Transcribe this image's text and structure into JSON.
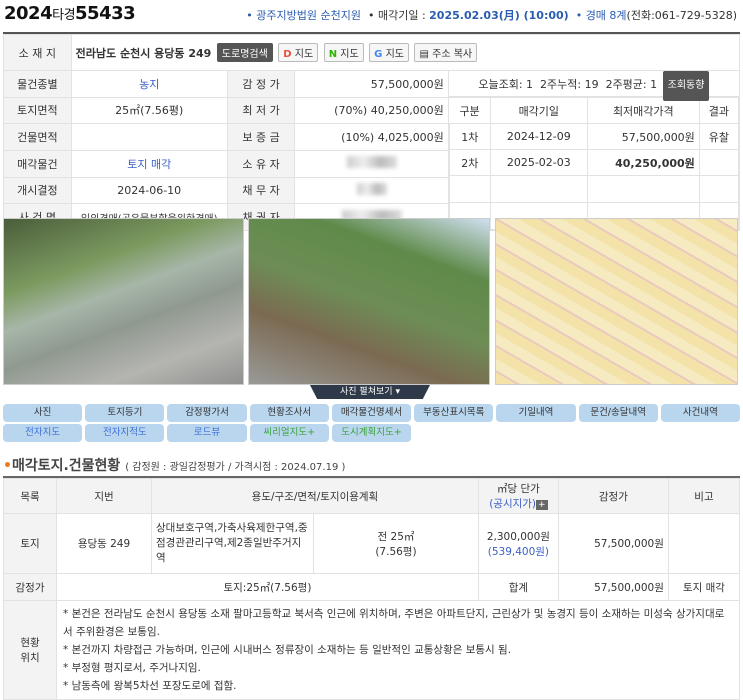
{
  "header": {
    "case_year": "2024",
    "case_type": "타경",
    "case_no": "55433",
    "court": "• 광주지방법원 순천지원",
    "sale_date_label": "• 매각기일 : ",
    "sale_date": "2025.02.03(月) (10:00)",
    "dept": "• 경매 8계",
    "phone": "(전화:061-729-5328)"
  },
  "info": {
    "address_label": "소 재 지",
    "address": "전라남도 순천시 용당동 249",
    "address_buttons": [
      "도로명검색",
      "지도",
      "지도",
      "지도",
      "주소 복사"
    ],
    "rows": [
      {
        "l1": "물건종별",
        "v1": "농지",
        "l2": "감 정 가",
        "v2": "57,500,000원"
      },
      {
        "l1": "토지면적",
        "v1": "25㎡(7.56평)",
        "l2": "최 저 가",
        "v2": "(70%) 40,250,000원"
      },
      {
        "l1": "건물면적",
        "v1": "",
        "l2": "보 증 금",
        "v2": "(10%) 4,025,000원"
      },
      {
        "l1": "매각물건",
        "v1": "토지 매각",
        "l2": "소 유 자",
        "v2": ""
      },
      {
        "l1": "개시결정",
        "v1": "2024-06-10",
        "l2": "채 무 자",
        "v2": ""
      },
      {
        "l1": "사 건 명",
        "v1": "임의경매(공유물분할을위한경매)",
        "l2": "채 권 자",
        "v2": ""
      }
    ],
    "views": "오늘조회: 1  2주누적: 19  2주평균: 1",
    "views_button": "조회동향",
    "history_headers": [
      "구분",
      "매각기일",
      "최저매각가격",
      "결과"
    ],
    "history": [
      {
        "round": "1차",
        "date": "2024-12-09",
        "price": "57,500,000원",
        "result": "유찰"
      },
      {
        "round": "2차",
        "date": "2025-02-03",
        "price": "40,250,000원",
        "result": ""
      }
    ]
  },
  "photos": {
    "spread_label": "사진 펼쳐보기"
  },
  "tabs_row1": [
    "사진",
    "토지등기",
    "감정평가서",
    "현황조사서",
    "매각물건명세서",
    "부동산표시목록",
    "기일내역",
    "문건/송달내역",
    "사건내역"
  ],
  "tabs_row2": [
    "전자지도",
    "전자지적도",
    "로드뷰",
    "씨리얼지도+",
    "도시계획지도+"
  ],
  "section": {
    "title": "매각토지.건물현황",
    "sub": "( 감정원 : 광일감정평가 / 가격시점 : 2024.07.19 )"
  },
  "land": {
    "headers": [
      "목록",
      "지번",
      "용도/구조/면적/토지이용계획",
      "㎡당 단가",
      "(공시지가)",
      "감정가",
      "비고"
    ],
    "row": {
      "type": "토지",
      "lot": "용당동 249",
      "use": "상대보호구역,가축사육제한구역,중점경관관리구역,제2종일반주거지역",
      "area1": "전 25㎡",
      "area2": "(7.56평)",
      "unit": "2,300,000원",
      "official": "(539,400원)",
      "appraisal": "57,500,000원",
      "note": ""
    },
    "sum": {
      "label": "감정가",
      "area": "토지:25㎡(7.56평)",
      "total_label": "합계",
      "total": "57,500,000원",
      "note": "토지 매각"
    },
    "loc_label": "현황\n위치",
    "loc": [
      "* 본건은 전라남도 순천시 용당동 소재 팔마고등학교 북서측 인근에 위치하며, 주변은 아파트단지, 근린상가 및 농경지 등이 소재하는 미성숙 상가지대로서 주위환경은 보통임.",
      "* 본건까지 차량접근 가능하며, 인근에 시내버스 정류장이 소재하는 등 일반적인 교통상황은 보통시 됨.",
      "* 부정형 평지로서, 주거나지임.",
      "* 남동측에 왕복5차선 포장도로에 접함."
    ]
  }
}
